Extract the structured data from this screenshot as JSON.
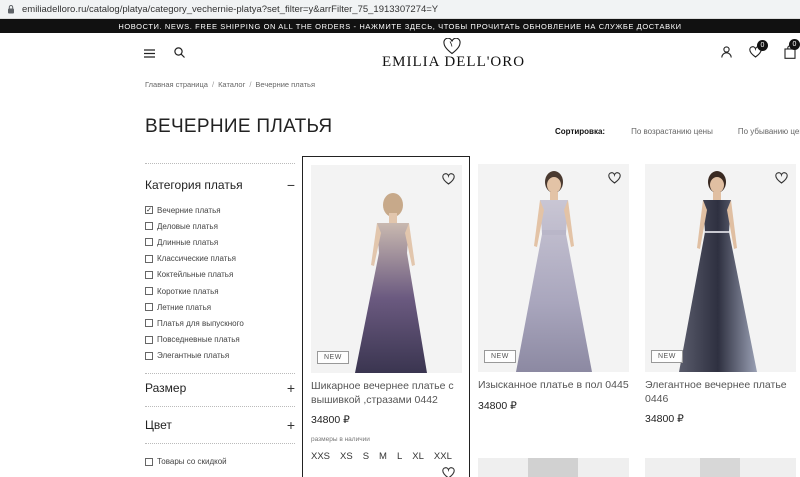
{
  "browser": {
    "url": "emiliadelloro.ru/catalog/platya/category_vechernie-platya?set_filter=y&arrFilter_75_1913307274=Y"
  },
  "announcement": "НОВОСТИ. NEWS. FREE SHIPPING ON ALL THE ORDERS - НАЖМИТЕ ЗДЕСЬ, ЧТОБЫ ПРОЧИТАТЬ ОБНОВЛЕНИЕ НА СЛУЖБЕ ДОСТАВКИ",
  "header": {
    "logo_text": "EMILIA DELL'ORO",
    "wishlist_count": "0",
    "cart_count": "0",
    "icons": [
      "menu-icon",
      "search-icon",
      "user-icon",
      "heart-icon",
      "bag-icon"
    ]
  },
  "breadcrumb": [
    "Главная страница",
    "Каталог",
    "Вечерние платья"
  ],
  "breadcrumb_sep": "/",
  "page_title": "ВЕЧЕРНИЕ ПЛАТЬЯ",
  "sort": {
    "label": "Сортировка:",
    "options": [
      "По возрастанию цены",
      "По убыванию цены"
    ]
  },
  "filters": {
    "category": {
      "title": "Категория платья",
      "toggle": "−",
      "items": [
        {
          "label": "Вечерние платья",
          "checked": true
        },
        {
          "label": "Деловые платья",
          "checked": false
        },
        {
          "label": "Длинные платья",
          "checked": false
        },
        {
          "label": "Классические платья",
          "checked": false
        },
        {
          "label": "Коктейльные платья",
          "checked": false
        },
        {
          "label": "Короткие платья",
          "checked": false
        },
        {
          "label": "Летние платья",
          "checked": false
        },
        {
          "label": "Платья для выпускного",
          "checked": false
        },
        {
          "label": "Повседневные платья",
          "checked": false
        },
        {
          "label": "Элегантные платья",
          "checked": false
        }
      ]
    },
    "size": {
      "title": "Размер",
      "toggle": "+"
    },
    "color": {
      "title": "Цвет",
      "toggle": "+"
    },
    "sale": {
      "label": "Товары со скидкой",
      "checked": false
    }
  },
  "products": [
    {
      "tag": "NEW",
      "title": "Шикарное вечернее платье с вышивкой ,стразами 0442",
      "price": "34800 ₽",
      "sizes_label": "размеры в наличии",
      "sizes": [
        "XXS",
        "XS",
        "S",
        "M",
        "L",
        "XL",
        "XXL"
      ],
      "dress_colors": [
        "#c9b9b0",
        "#6b5a80",
        "#3a3550"
      ]
    },
    {
      "tag": "NEW",
      "title": "Изысканное платье в пол 0445",
      "price": "34800 ₽",
      "dress_colors": [
        "#c9c6d4",
        "#a9a6bd",
        "#8c89a2"
      ]
    },
    {
      "tag": "NEW",
      "title": "Элегантное вечернее платье 0446",
      "price": "34800 ₽",
      "dress_colors": [
        "#5a5c6c",
        "#2e3040",
        "#9aa0b4"
      ]
    }
  ]
}
